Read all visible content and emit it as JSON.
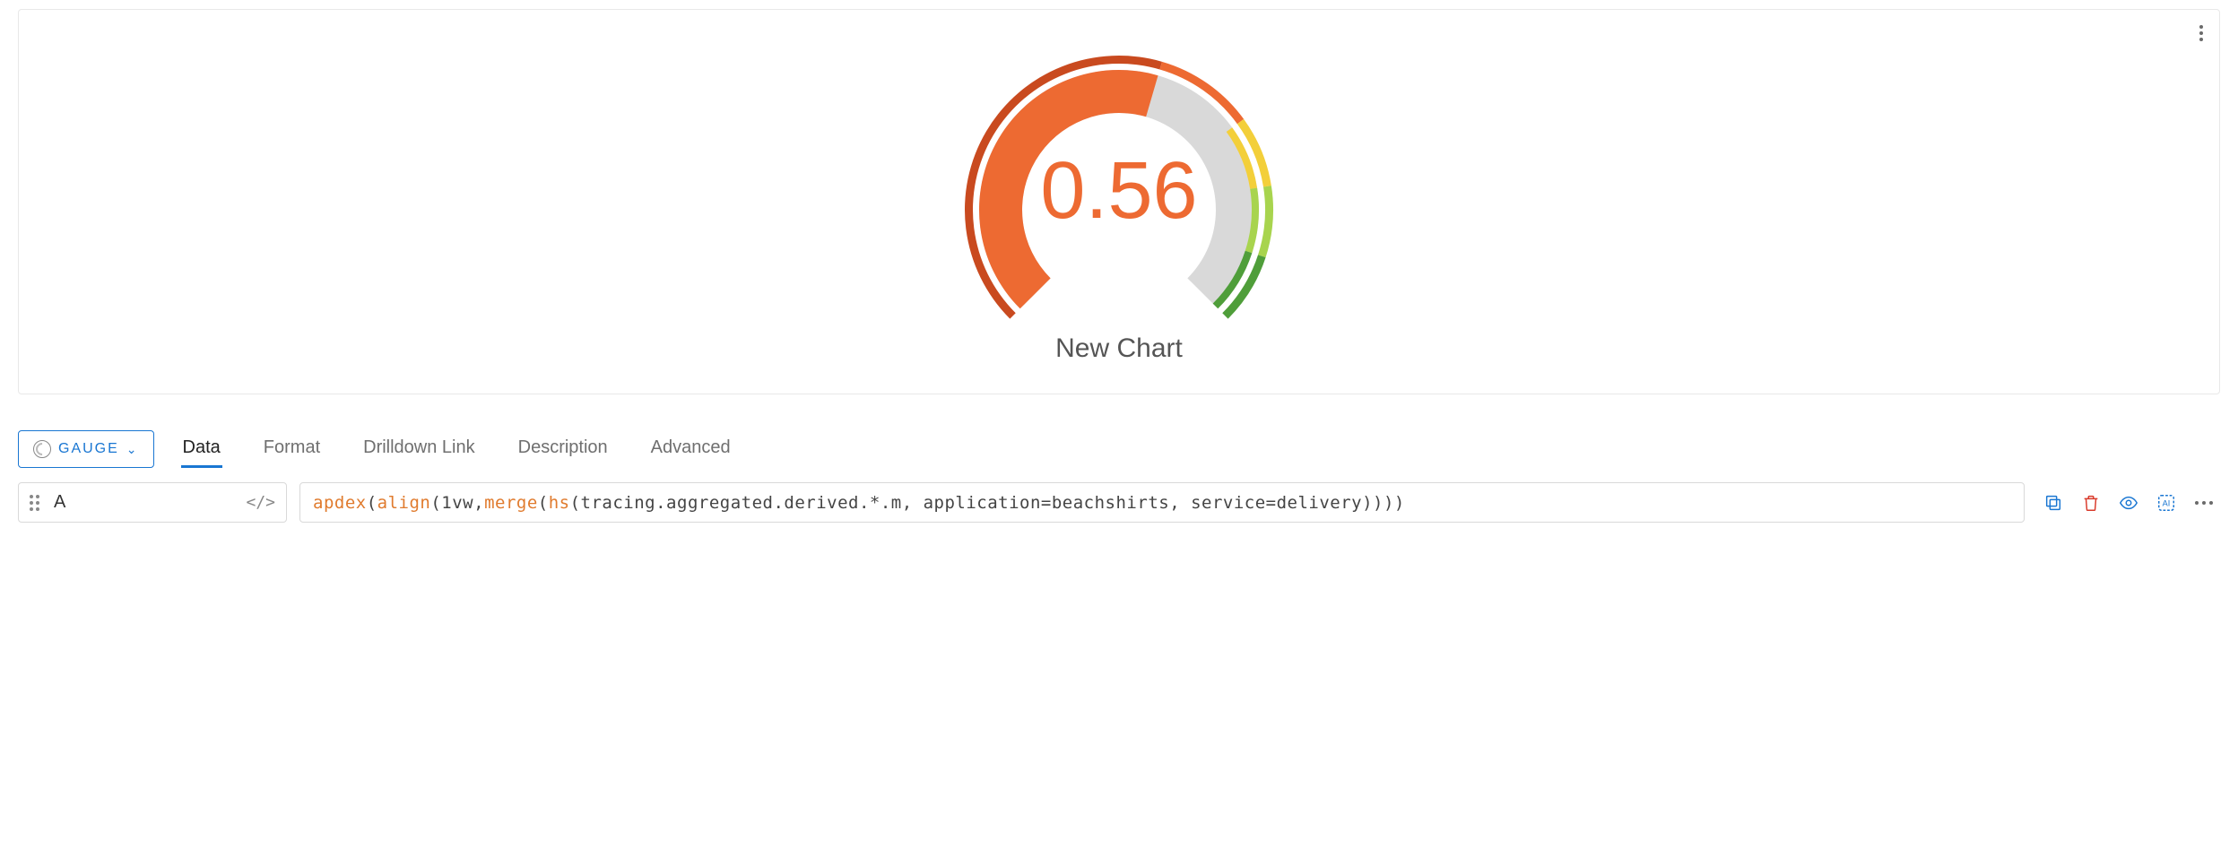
{
  "chart_data": {
    "type": "gauge",
    "value": 0.56,
    "value_display": "0.56",
    "title": "New Chart",
    "range": [
      0,
      1
    ],
    "thresholds": [
      {
        "from": 0.0,
        "to": 0.56,
        "color": "#ed6a32",
        "label": "current-fill"
      },
      {
        "from": 0.56,
        "to": 0.7,
        "color": "#d9d9d9",
        "label": "empty"
      },
      {
        "from": 0.7,
        "to": 0.8,
        "color": "#f3cf3a",
        "label": "yellow"
      },
      {
        "from": 0.8,
        "to": 0.9,
        "color": "#a8d44e",
        "label": "light-green"
      },
      {
        "from": 0.9,
        "to": 1.0,
        "color": "#4f9e3a",
        "label": "green"
      }
    ],
    "outer_ring": [
      {
        "from": 0.0,
        "to": 0.56,
        "color": "#c94a1f"
      },
      {
        "from": 0.56,
        "to": 0.7,
        "color": "#ed6a32"
      },
      {
        "from": 0.7,
        "to": 0.8,
        "color": "#f3cf3a"
      },
      {
        "from": 0.8,
        "to": 0.9,
        "color": "#a8d44e"
      },
      {
        "from": 0.9,
        "to": 1.0,
        "color": "#4f9e3a"
      }
    ]
  },
  "chart_type_button": {
    "label": "GAUGE"
  },
  "tabs": [
    {
      "label": "Data",
      "active": true
    },
    {
      "label": "Format",
      "active": false
    },
    {
      "label": "Drilldown Link",
      "active": false
    },
    {
      "label": "Description",
      "active": false
    },
    {
      "label": "Advanced",
      "active": false
    }
  ],
  "query": {
    "name": "A",
    "tokens": [
      {
        "t": "fn",
        "v": "apdex"
      },
      {
        "t": "rest",
        "v": "("
      },
      {
        "t": "fn",
        "v": "align"
      },
      {
        "t": "rest",
        "v": "(1vw, "
      },
      {
        "t": "fn",
        "v": "merge"
      },
      {
        "t": "rest",
        "v": "("
      },
      {
        "t": "fn",
        "v": "hs"
      },
      {
        "t": "rest",
        "v": "(tracing.aggregated.derived.*.m, application=beachshirts, service=delivery))))"
      }
    ]
  }
}
